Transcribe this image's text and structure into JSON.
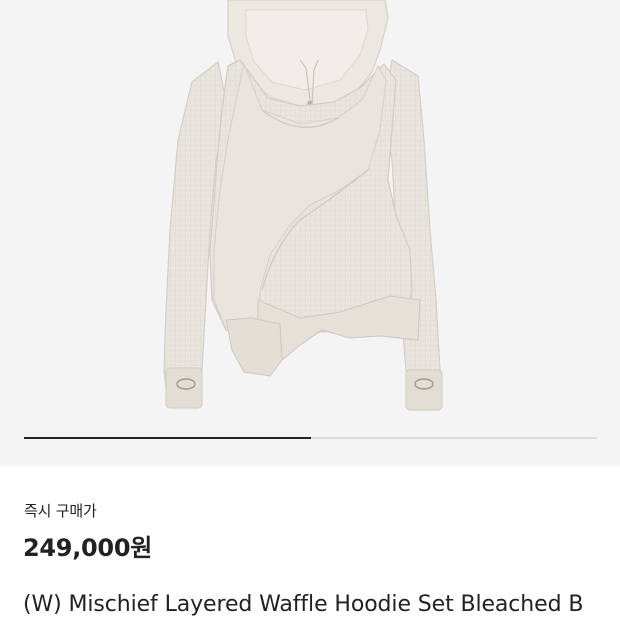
{
  "carousel": {
    "progress": 0.5
  },
  "product": {
    "image_alt": "",
    "price_label": "즉시 구매가",
    "price": "249,000원",
    "name": "(W) Mischief Layered Waffle Hoodie Set Bleached B"
  },
  "colors": {
    "garment": "#e7e2dc",
    "image_background": "#f4f4f4",
    "text": "#222222",
    "progress_fill": "#222222",
    "progress_track": "#dcdcdc"
  }
}
